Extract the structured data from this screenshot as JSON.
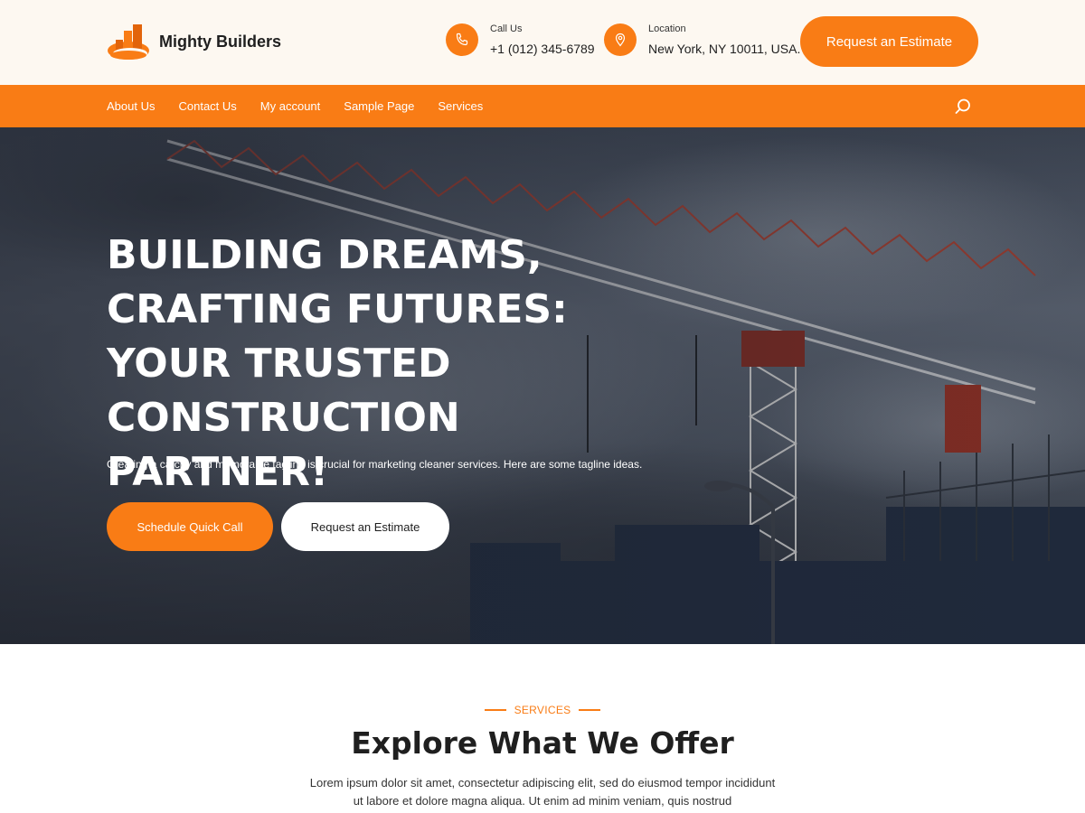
{
  "header": {
    "brand": "Mighty Builders",
    "call_label": "Call Us",
    "call_value": "+1 (012) 345-6789",
    "location_label": "Location",
    "location_value": "New York, NY 10011, USA.",
    "cta": "Request an Estimate"
  },
  "nav": {
    "items": [
      "About Us",
      "Contact Us",
      "My account",
      "Sample Page",
      "Services"
    ]
  },
  "hero": {
    "title": "BUILDING DREAMS, CRAFTING FUTURES: YOUR TRUSTED CONSTRUCTION PARTNER!",
    "subtitle": "Creating a catchy and memorable tagline is crucial for marketing cleaner services. Here are some tagline ideas.",
    "primary_button": "Schedule Quick Call",
    "secondary_button": "Request an Estimate"
  },
  "services": {
    "eyebrow": "SERVICES",
    "title": "Explore What We Offer",
    "description": "Lorem ipsum dolor sit amet, consectetur adipiscing elit, sed do eiusmod tempor incididunt ut labore et dolore magna aliqua. Ut enim ad minim veniam, quis nostrud"
  },
  "colors": {
    "accent": "#f97c15",
    "header_bg": "#fdf8f1",
    "hero_overlay": "#2b303a"
  },
  "icons": {
    "logo": "building-logo-icon",
    "call": "phone-icon",
    "location": "map-pin-icon",
    "search": "search-icon"
  }
}
